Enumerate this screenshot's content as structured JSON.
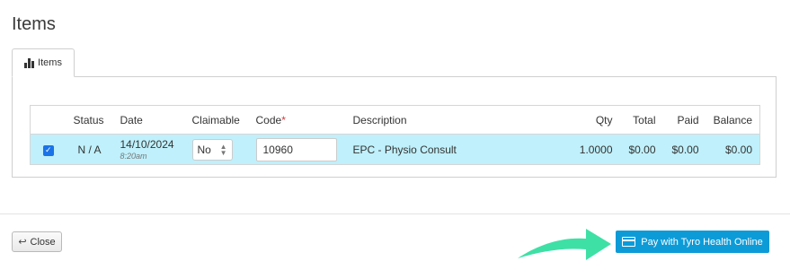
{
  "page": {
    "title": "Items"
  },
  "tabs": [
    {
      "label": "Items",
      "icon": "bar-chart-icon"
    }
  ],
  "table": {
    "headers": {
      "status": "Status",
      "date": "Date",
      "claimable": "Claimable",
      "code": "Code",
      "code_required_mark": "*",
      "description": "Description",
      "qty": "Qty",
      "total": "Total",
      "paid": "Paid",
      "balance": "Balance"
    },
    "rows": [
      {
        "selected": true,
        "status": "N / A",
        "date": "14/10/2024",
        "time": "8:20am",
        "claimable": "No",
        "code": "10960",
        "description": "EPC - Physio Consult",
        "qty": "1.0000",
        "total": "$0.00",
        "paid": "$0.00",
        "balance": "$0.00"
      }
    ]
  },
  "footer": {
    "close_label": "Close",
    "close_icon": "reply-icon",
    "pay_label": "Pay with Tyro Health Online",
    "pay_icon": "credit-card-icon",
    "arrow_icon": "arrow-right-icon"
  },
  "colors": {
    "row_highlight": "#bff0fb",
    "pay_button": "#0d9bd8",
    "arrow": "#3ee0a6",
    "required": "#e0333a"
  }
}
